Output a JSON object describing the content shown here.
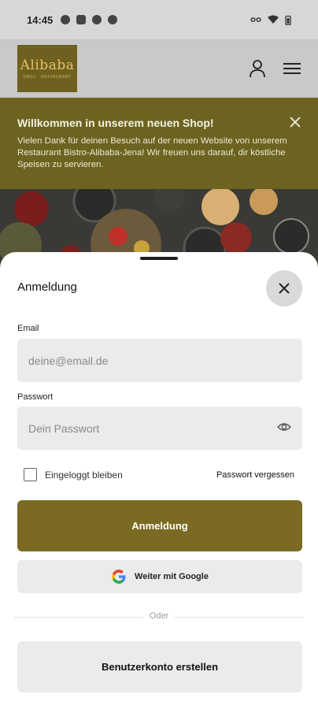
{
  "status_bar": {
    "time": "14:45"
  },
  "header": {
    "logo_text": "Alibaba",
    "logo_subtext": "GRILL · RESTAURANT"
  },
  "banner": {
    "title": "Willkommen in unserem neuen Shop!",
    "text": "Vielen Dank für deinen Besuch auf der neuen Website von unserem Restaurant Bistro-Alibaba-Jena! Wir freuen uns darauf, dir köstliche Speisen zu servieren."
  },
  "login_sheet": {
    "title": "Anmeldung",
    "email_label": "Email",
    "email_placeholder": "deine@email.de",
    "password_label": "Passwort",
    "password_placeholder": "Dein Passwort",
    "remember_label": "Eingeloggt bleiben",
    "forgot_label": "Passwort vergessen",
    "login_button": "Anmeldung",
    "google_button": "Weiter mit Google",
    "divider_text": "Oder",
    "register_button": "Benutzerkonto erstellen"
  },
  "colors": {
    "brand": "#7a6a22",
    "banner": "#6c6320"
  }
}
